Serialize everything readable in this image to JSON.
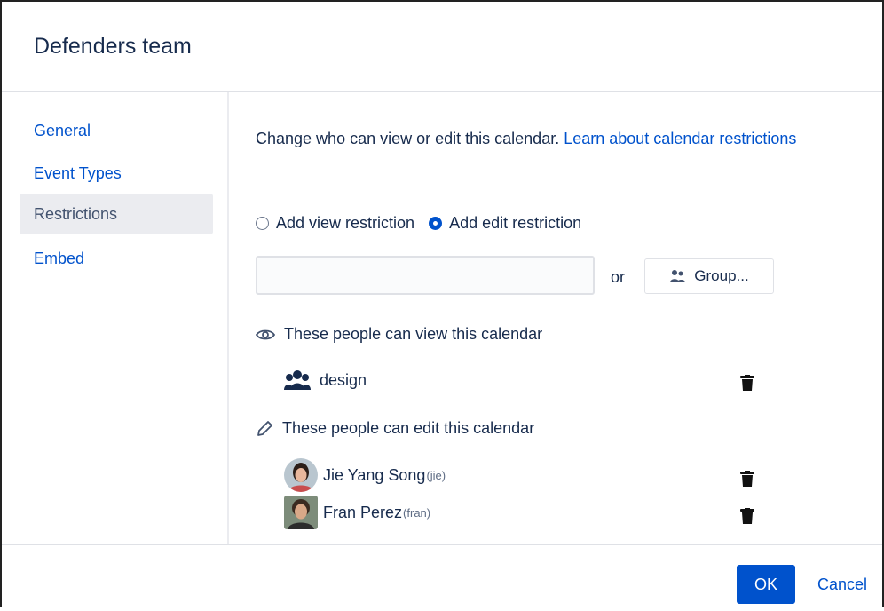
{
  "dialog": {
    "title": "Defenders team"
  },
  "sidebar": {
    "items": [
      {
        "label": "General",
        "active": false
      },
      {
        "label": "Event Types",
        "active": false
      },
      {
        "label": "Restrictions",
        "active": true
      },
      {
        "label": "Embed",
        "active": false
      }
    ]
  },
  "intro": {
    "text": "Change who can view or edit this calendar.",
    "link": "Learn about calendar restrictions"
  },
  "restriction_mode": {
    "view_label": "Add view restriction",
    "edit_label": "Add edit restriction",
    "selected": "edit"
  },
  "search": {
    "value": "",
    "placeholder": ""
  },
  "or_label": "or",
  "group_button": {
    "label": "Group...",
    "icon": "group-icon"
  },
  "view_section": {
    "title": "These people can view this calendar",
    "icon": "eye-icon",
    "entries": [
      {
        "name": "design",
        "username": "",
        "type": "group"
      }
    ]
  },
  "edit_section": {
    "title": "These people can edit this calendar",
    "icon": "pencil-icon",
    "entries": [
      {
        "name": "Jie Yang Song",
        "username": "(jie)",
        "type": "user"
      },
      {
        "name": "Fran Perez",
        "username": "(fran)",
        "type": "user"
      }
    ]
  },
  "footer": {
    "ok_label": "OK",
    "cancel_label": "Cancel"
  },
  "colors": {
    "primary": "#0052cc",
    "text": "#172b4d",
    "nav_active_bg": "#ebecf0"
  }
}
